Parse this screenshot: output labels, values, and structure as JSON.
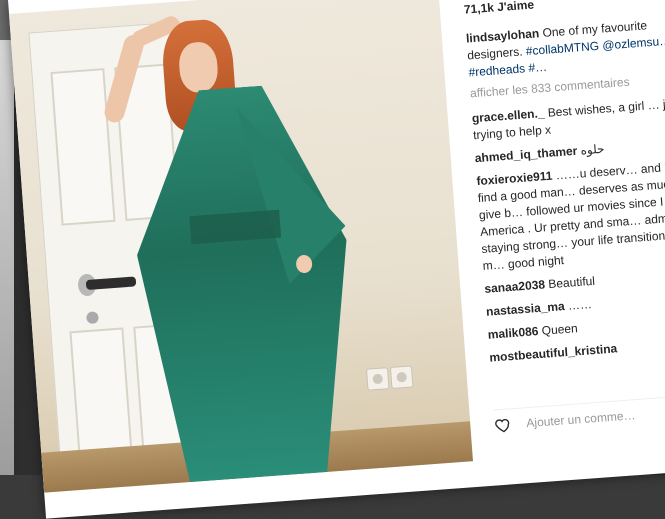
{
  "post": {
    "likes": "71,1k J'aime",
    "caption": {
      "user": "lindsaylohan",
      "text": "One of my favourite designers.",
      "tags": [
        "#collabMTNG",
        "@ozlemsu…",
        "#redheads",
        "#…"
      ]
    },
    "view_comments": "afficher les 833 commentaires"
  },
  "comments": [
    {
      "user": "grace.ellen._",
      "text": "Best wishes, a girl … just trying to help x"
    },
    {
      "user": "ahmed_iq_thamer",
      "text": "حلوه"
    },
    {
      "user": "foxieroxie911",
      "text": "……u deserv… and I hope u find a good man… deserves as much as u give b… followed ur movies since I ca… America . Ur pretty and sma… admire u for staying strong… your life transition in the m… good night"
    },
    {
      "user": "sanaa2038",
      "text": "Beautiful"
    },
    {
      "user": "nastassia_ma",
      "text": "……"
    },
    {
      "user": "malik086",
      "text": "Queen"
    },
    {
      "user": "mostbeautiful_kristina",
      "text": ""
    }
  ],
  "composer": {
    "placeholder": "Ajouter un comme…"
  }
}
